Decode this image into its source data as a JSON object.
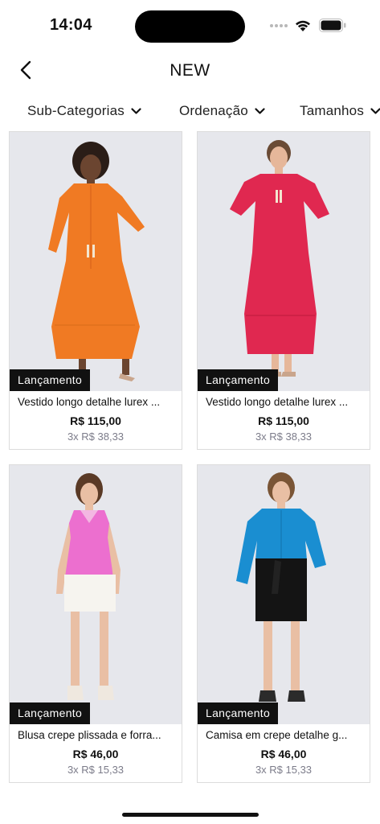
{
  "status_bar": {
    "time": "14:04"
  },
  "header": {
    "title": "NEW"
  },
  "filters": [
    {
      "label": "Sub-Categorias"
    },
    {
      "label": "Ordenação"
    },
    {
      "label": "Tamanhos"
    }
  ],
  "products": [
    {
      "badge": "Lançamento",
      "name": "Vestido longo detalhe lurex ...",
      "price": "R$ 115,00",
      "installments": "3x R$ 38,33",
      "garment_color": "#f07a23"
    },
    {
      "badge": "Lançamento",
      "name": "Vestido longo detalhe lurex ...",
      "price": "R$ 115,00",
      "installments": "3x R$ 38,33",
      "garment_color": "#e02850"
    },
    {
      "badge": "Lançamento",
      "name": "Blusa crepe plissada e forra...",
      "price": "R$ 46,00",
      "installments": "3x R$ 15,33",
      "garment_color": "#ec6fcf"
    },
    {
      "badge": "Lançamento",
      "name": "Camisa em crepe detalhe g...",
      "price": "R$ 46,00",
      "installments": "3x R$ 15,33",
      "garment_color": "#1a8ed1"
    }
  ]
}
